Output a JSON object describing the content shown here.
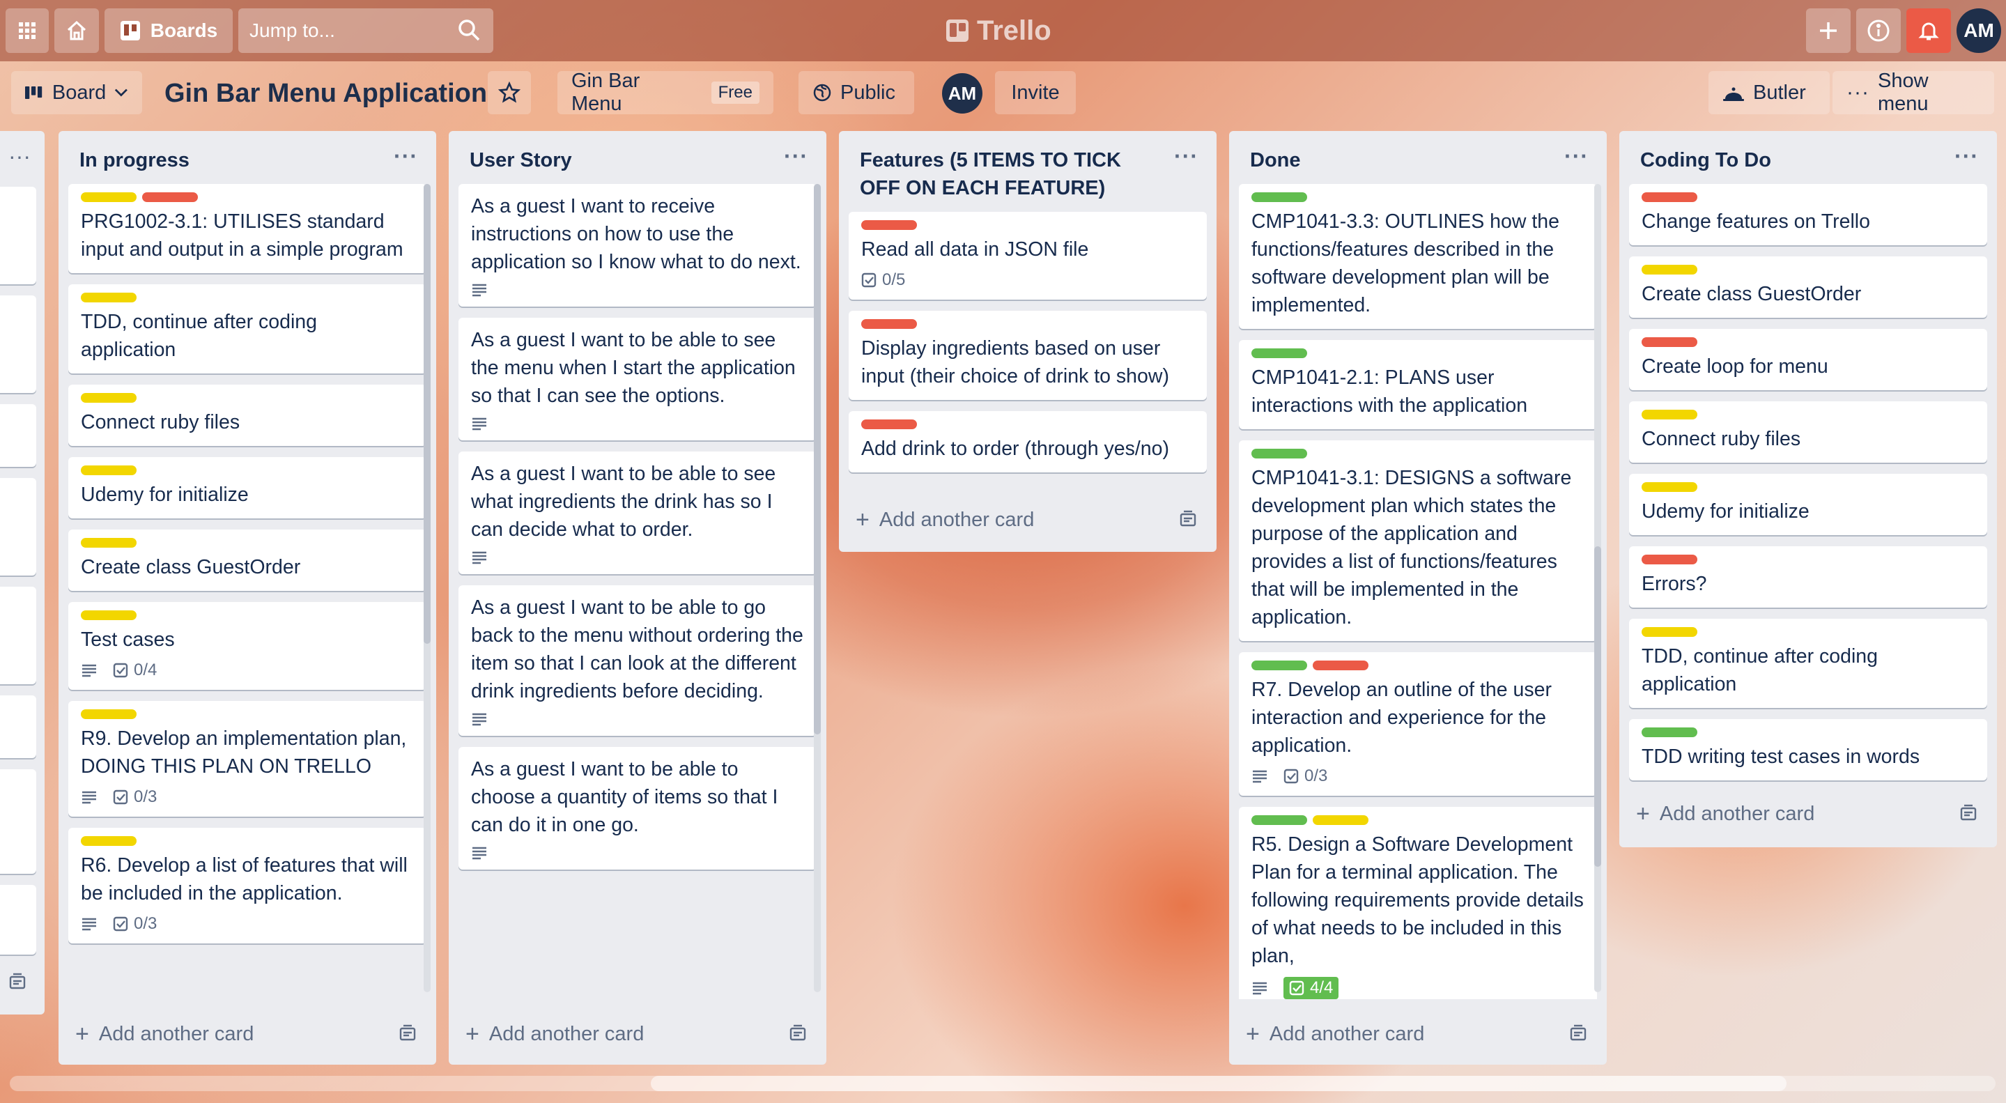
{
  "topnav": {
    "boards_label": "Boards",
    "search_placeholder": "Jump to...",
    "logo_text": "Trello",
    "avatar_initials": "AM"
  },
  "board_header": {
    "view_label": "Board",
    "board_title": "Gin Bar Menu Application",
    "team_name": "Gin Bar Menu",
    "team_plan": "Free",
    "visibility": "Public",
    "member_initials": "AM",
    "invite_label": "Invite",
    "butler_label": "Butler",
    "show_menu_label": "Show menu"
  },
  "colors": {
    "yellow": "#f2d600",
    "red": "#eb5a46",
    "green": "#61bd4f",
    "list_bg": "#ebecf0"
  },
  "add_card_label": "Add another card",
  "lists": {
    "in_progress": {
      "title": "In progress",
      "cards": [
        {
          "text": "PRG1002-3.1: UTILISES standard input and output in a simple program",
          "labels": [
            "yellow",
            "red"
          ]
        },
        {
          "text": "TDD, continue after coding application",
          "labels": [
            "yellow"
          ]
        },
        {
          "text": "Connect ruby files",
          "labels": [
            "yellow"
          ]
        },
        {
          "text": "Udemy for initialize",
          "labels": [
            "yellow"
          ]
        },
        {
          "text": "Create class GuestOrder",
          "labels": [
            "yellow"
          ]
        },
        {
          "text": "Test cases",
          "labels": [
            "yellow"
          ],
          "checklist": "0/4"
        },
        {
          "text": "R9. Develop an implementation plan, DOING THIS PLAN ON TRELLO",
          "labels": [
            "yellow"
          ],
          "checklist": "0/3"
        },
        {
          "text": "R6. Develop a list of features that will be included in the application.",
          "labels": [
            "yellow"
          ],
          "checklist": "0/3"
        }
      ]
    },
    "user_story": {
      "title": "User Story",
      "cards": [
        {
          "text": "As a guest I want to receive instructions on how to use the application so I know what to do next."
        },
        {
          "text": "As a guest I want to be able to see the menu when I start the application so that I can see the options."
        },
        {
          "text": "As a guest I want to be able to see what ingredients the drink has so I can decide what to order."
        },
        {
          "text": "As a guest I want to be able to go back to the menu without ordering the item so that I can look at the different drink ingredients before deciding."
        },
        {
          "text": "As a guest I want to be able to choose a quantity of items so that I can do it in one go."
        }
      ]
    },
    "features": {
      "title": "Features (5 ITEMS TO TICK OFF ON EACH FEATURE)",
      "cards": [
        {
          "text": "Read all data in JSON file",
          "labels": [
            "red"
          ],
          "checklist": "0/5"
        },
        {
          "text": "Display ingredients based on user input (their choice of drink to show)",
          "labels": [
            "red"
          ]
        },
        {
          "text": "Add drink to order (through yes/no)",
          "labels": [
            "red"
          ]
        }
      ]
    },
    "done": {
      "title": "Done",
      "cards": [
        {
          "text": "CMP1041-3.3: OUTLINES how the functions/features described in the software development plan will be implemented.",
          "labels": [
            "green"
          ]
        },
        {
          "text": "CMP1041-2.1: PLANS user interactions with the application",
          "labels": [
            "green"
          ]
        },
        {
          "text": "CMP1041-3.1: DESIGNS a software development plan which states the purpose of the application and provides a list of functions/features that will be implemented in the application.",
          "labels": [
            "green"
          ]
        },
        {
          "text": "R7. Develop an outline of the user interaction and experience for the application.",
          "labels": [
            "green",
            "red"
          ],
          "checklist": "0/3"
        },
        {
          "text": "R5. Design a Software Development Plan for a terminal application. The following requirements provide details of what needs to be included in this plan,",
          "labels": [
            "green",
            "yellow"
          ],
          "checklist": "4/4"
        }
      ]
    },
    "coding_todo": {
      "title": "Coding To Do",
      "cards": [
        {
          "text": "Change features on Trello",
          "labels": [
            "red"
          ]
        },
        {
          "text": "Create class GuestOrder",
          "labels": [
            "yellow"
          ]
        },
        {
          "text": "Create loop for menu",
          "labels": [
            "red"
          ]
        },
        {
          "text": "Connect ruby files",
          "labels": [
            "yellow"
          ]
        },
        {
          "text": "Udemy for initialize",
          "labels": [
            "yellow"
          ]
        },
        {
          "text": "Errors?",
          "labels": [
            "red"
          ]
        },
        {
          "text": "TDD, continue after coding application",
          "labels": [
            "yellow"
          ]
        },
        {
          "text": "TDD writing test cases in words",
          "labels": [
            "green"
          ]
        }
      ]
    }
  }
}
